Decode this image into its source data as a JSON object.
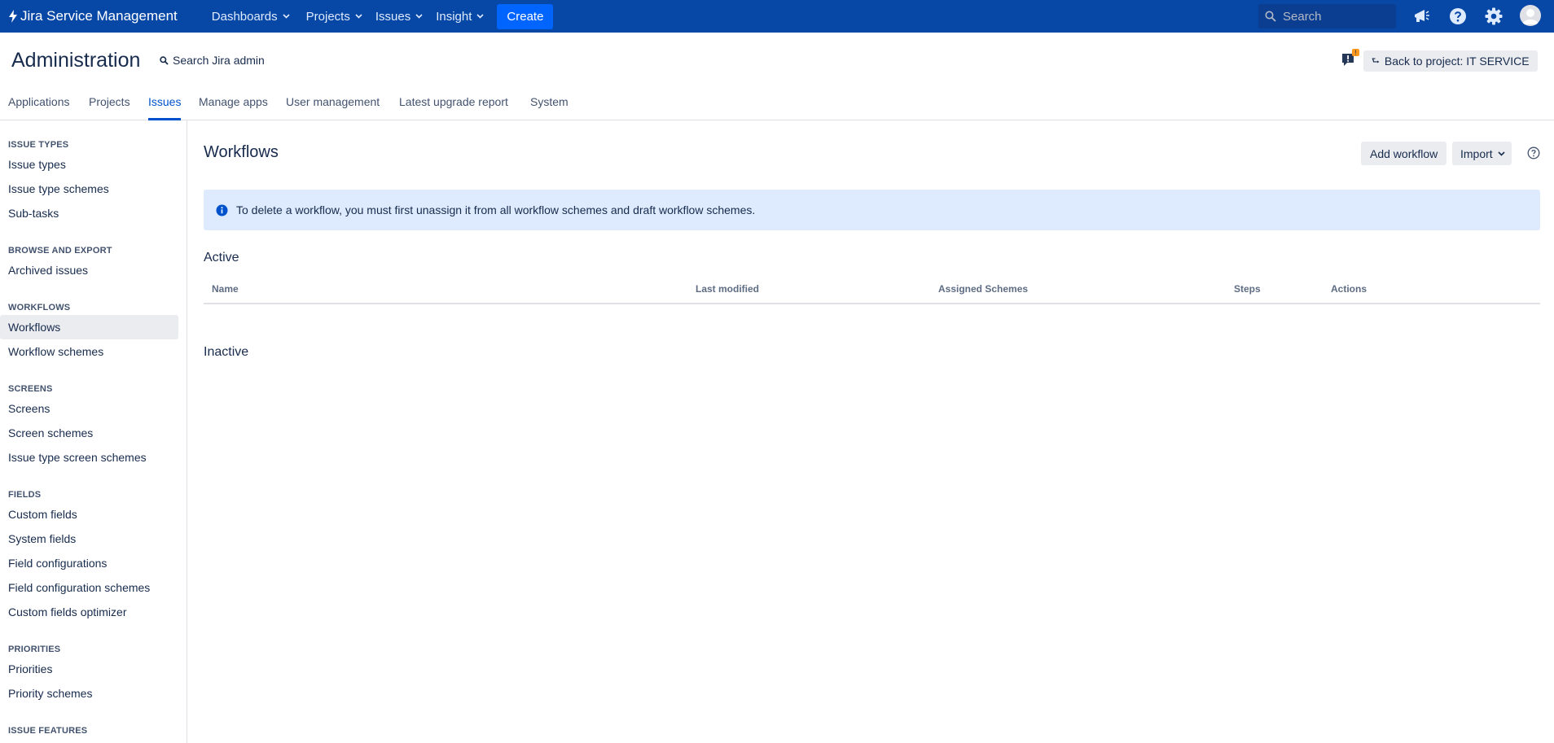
{
  "topnav": {
    "product_name": "Jira Service Management",
    "dashboards": "Dashboards",
    "projects": "Projects",
    "issues": "Issues",
    "insight": "Insight",
    "create": "Create",
    "search_placeholder": "Search",
    "icons": [
      "notifications-icon",
      "help-icon",
      "settings-icon",
      "avatar"
    ]
  },
  "admin": {
    "title": "Administration",
    "search_label": "Search Jira admin",
    "feedback_badge": "!",
    "back_button": "Back to project: IT SERVICE"
  },
  "tabs": [
    {
      "label": "Applications",
      "active": false
    },
    {
      "label": "Projects",
      "active": false
    },
    {
      "label": "Issues",
      "active": true
    },
    {
      "label": "Manage apps",
      "active": false
    },
    {
      "label": "User management",
      "active": false
    },
    {
      "label": "Latest upgrade report",
      "active": false
    },
    {
      "label": "System",
      "active": false
    }
  ],
  "sidebar": {
    "issue_types_heading": "ISSUE TYPES",
    "issue_types": "Issue types",
    "issue_type_schemes": "Issue type schemes",
    "sub_tasks": "Sub-tasks",
    "browse_heading": "BROWSE AND EXPORT",
    "archived_issues": "Archived issues",
    "workflows_heading": "WORKFLOWS",
    "workflows": "Workflows",
    "workflow_schemes": "Workflow schemes",
    "screens_heading": "SCREENS",
    "screens": "Screens",
    "screen_schemes": "Screen schemes",
    "issue_type_screen_schemes": "Issue type screen schemes",
    "fields_heading": "FIELDS",
    "custom_fields": "Custom fields",
    "system_fields": "System fields",
    "field_configurations": "Field configurations",
    "field_configuration_schemes": "Field configuration schemes",
    "custom_fields_optimizer": "Custom fields optimizer",
    "priorities_heading": "PRIORITIES",
    "priorities": "Priorities",
    "priority_schemes": "Priority schemes",
    "issue_features_heading": "ISSUE FEATURES"
  },
  "main": {
    "title": "Workflows",
    "add_workflow": "Add workflow",
    "import": "Import",
    "info_message": "To delete a workflow, you must first unassign it from all workflow schemes and draft workflow schemes.",
    "active_heading": "Active",
    "inactive_heading": "Inactive",
    "columns": {
      "name": "Name",
      "last_modified": "Last modified",
      "assigned_schemes": "Assigned Schemes",
      "steps": "Steps",
      "actions": "Actions"
    }
  },
  "colors": {
    "topnav_bg": "#0747a6",
    "create_btn": "#0065ff",
    "active_tab": "#0052cc",
    "info_banner_bg": "#deebff",
    "badge": "#ff991f"
  }
}
